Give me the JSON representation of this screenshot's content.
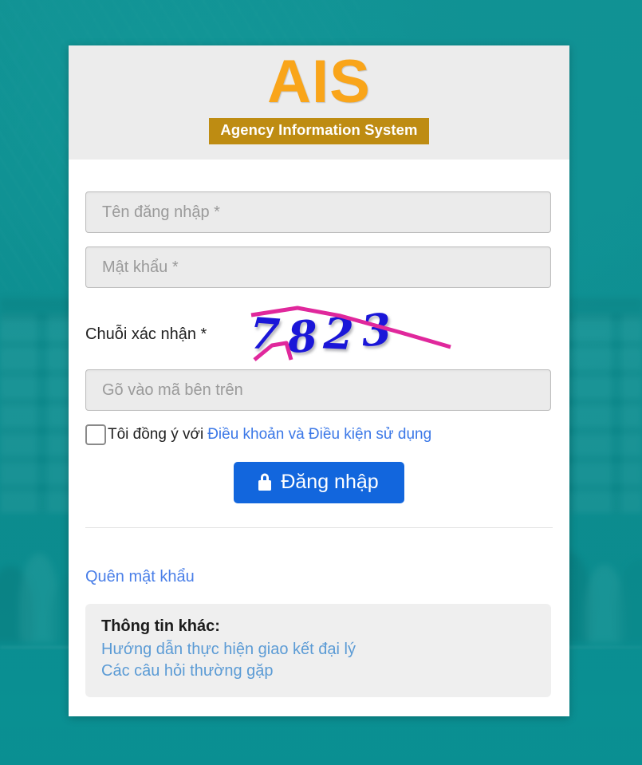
{
  "background": {
    "description": "blurred teal-tinted event hall photo",
    "overlay_color": "#0c8c8f"
  },
  "card": {
    "header": {
      "logo_text": "AIS",
      "logo_color": "#f9a51a",
      "subtitle": "Agency Information System",
      "subtitle_bg": "#be8c12"
    },
    "form": {
      "username": {
        "value": "",
        "placeholder": "Tên đăng nhập *"
      },
      "password": {
        "value": "",
        "placeholder": "Mật khẩu *"
      },
      "captcha": {
        "label": "Chuỗi xác nhận *",
        "image_code": "7823",
        "digit_color": "#1a16d8",
        "noise_color": "#e0289c",
        "input": {
          "value": "",
          "placeholder": "Gõ vào mã bên trên"
        }
      },
      "agree": {
        "checked": false,
        "text": "Tôi đồng ý với",
        "link_text": "Điều khoản và Điều kiện sử dụng",
        "link_color": "#3b78e7"
      },
      "submit": {
        "label": "Đăng nhập",
        "icon": "lock-icon",
        "bg_color": "#1266dd"
      }
    },
    "footer": {
      "forgot_password": "Quên mật khẩu",
      "info": {
        "title": "Thông tin khác:",
        "links": [
          "Hướng dẫn thực hiện giao kết đại lý",
          "Các câu hỏi thường gặp"
        ],
        "link_color": "#5b9bd5"
      }
    }
  }
}
